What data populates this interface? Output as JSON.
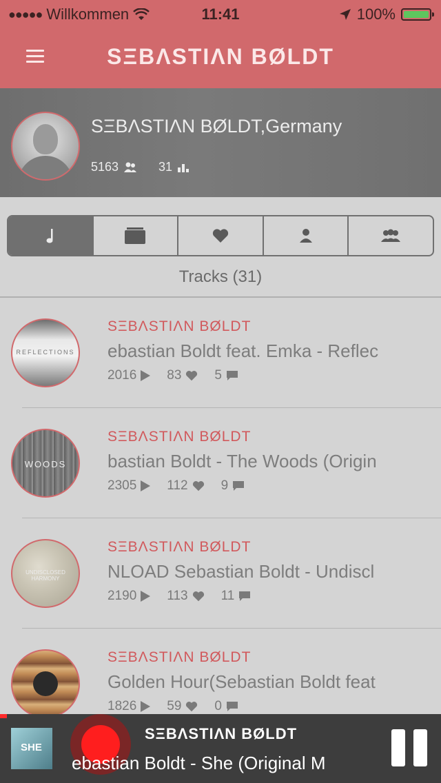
{
  "status_bar": {
    "carrier": "Willkommen",
    "time": "11:41",
    "battery": "100%"
  },
  "nav": {
    "title": "SΞBΛSTIΛN BØLDT"
  },
  "profile": {
    "name": "SΞBΛSTIΛN BØLDT,Germany",
    "followers": "5163",
    "tracks_count": "31"
  },
  "tabs": [
    {
      "icon": "music-note-icon"
    },
    {
      "icon": "album-icon"
    },
    {
      "icon": "heart-icon"
    },
    {
      "icon": "person-icon"
    },
    {
      "icon": "group-icon"
    }
  ],
  "section_title": "Tracks (31)",
  "tracks": [
    {
      "artist": "SΞBΛSTIΛN BØLDT",
      "title": "ebastian Boldt feat. Emka - Reflec",
      "plays": "2016",
      "likes": "83",
      "comments": "5",
      "cover_label": "REFLECTIONS"
    },
    {
      "artist": "SΞBΛSTIΛN BØLDT",
      "title": "bastian Boldt - The Woods (Origin",
      "plays": "2305",
      "likes": "112",
      "comments": "9",
      "cover_label": "WOODS"
    },
    {
      "artist": "SΞBΛSTIΛN BØLDT",
      "title": "NLOAD Sebastian Boldt - Undiscl",
      "plays": "2190",
      "likes": "113",
      "comments": "11",
      "cover_label": "UNDISCLOSED HARMONY"
    },
    {
      "artist": "SΞBΛSTIΛN BØLDT",
      "title": "Golden Hour(Sebastian Boldt feat",
      "plays": "1826",
      "likes": "59",
      "comments": "0",
      "cover_label": ""
    }
  ],
  "player": {
    "artist": "SΞBΛSTIΛN BØLDT",
    "title": "ebastian Boldt - She (Original M",
    "thumb_label": "SHE",
    "progress": 0.016
  },
  "colors": {
    "accent": "#d1696c",
    "header": "#707070",
    "background": "#d4d4d4",
    "player": "#3d3d3d"
  }
}
